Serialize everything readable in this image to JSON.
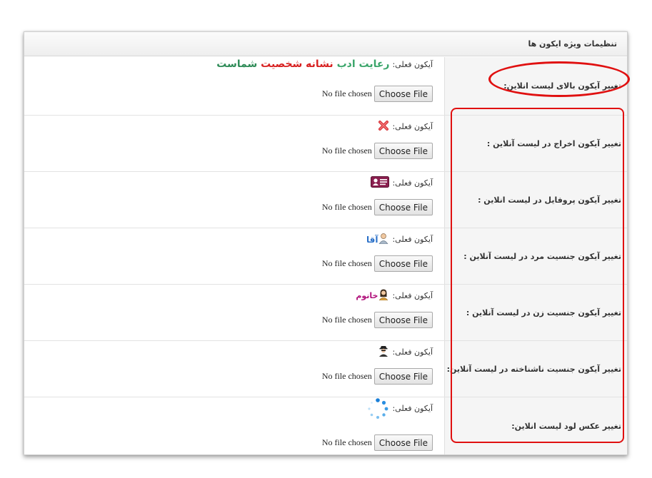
{
  "panel": {
    "title": "تنظیمات ویژه ایکون ها"
  },
  "common": {
    "current_label": "آیکون فعلی:",
    "no_file": "No file chosen",
    "choose_file": "Choose File"
  },
  "rows": [
    {
      "label": "تغییر آیکون بالای لیست انلاین:",
      "brand": {
        "part1": "رعایت ادب",
        "part2": "نشانه شخصیت",
        "part3": "شماست"
      }
    },
    {
      "label": "تغییر آیکون اخراج در لیست آنلاین :",
      "icon": "red-x-icon"
    },
    {
      "label": "تغییر آیکون پروفایل در لیست انلاین :",
      "icon": "profile-card-icon"
    },
    {
      "label": "تغییر آیکون جنسیت مرد در لیست آنلاین :",
      "icon": "male-user-icon",
      "icon_text": "آقا"
    },
    {
      "label": "تغییر آیکون جنسیت زن در لیست آنلاین :",
      "icon": "female-user-icon",
      "icon_text": "خانوم"
    },
    {
      "label": "تغییر آیکون جنسیت ناشناخته در لیست آنلاین:",
      "icon": "unknown-user-icon"
    },
    {
      "label": "تغییر عکس لود لیست انلاین:",
      "icon": "loading-spinner-icon"
    }
  ],
  "colors": {
    "annotation": "#e01010",
    "brand_green": "#3aa56a",
    "brand_red": "#d72020",
    "agha_blue": "#2a70c8",
    "khanom_magenta": "#b0107a"
  }
}
